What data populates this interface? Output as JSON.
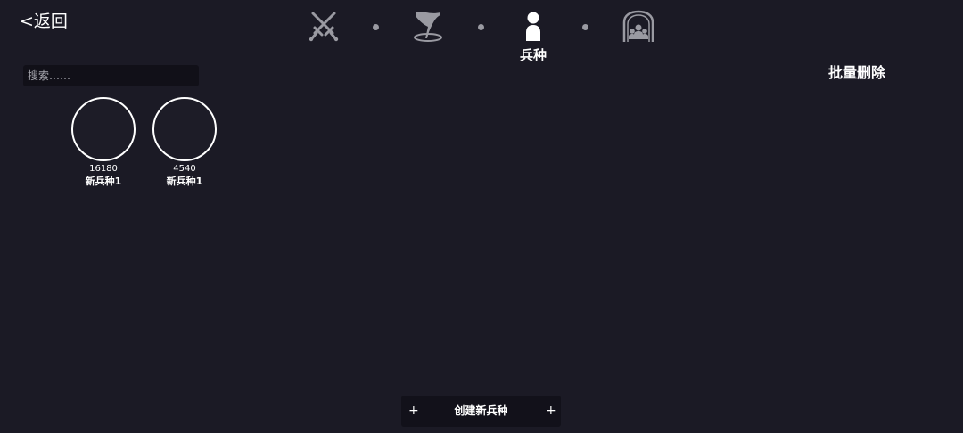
{
  "header": {
    "back_label": "<返回",
    "batch_delete_label": "批量删除"
  },
  "nav": {
    "steps": [
      {
        "icon": "crossed-swords-icon",
        "label": "",
        "active": false
      },
      {
        "icon": "flag-icon",
        "label": "",
        "active": false
      },
      {
        "icon": "soldier-icon",
        "label": "兵种",
        "active": true
      },
      {
        "icon": "army-group-icon",
        "label": "",
        "active": false
      }
    ]
  },
  "search": {
    "placeholder": "搜索……",
    "value": ""
  },
  "units": [
    {
      "count": "16180",
      "name": "新兵种1"
    },
    {
      "count": "4540",
      "name": "新兵种1"
    }
  ],
  "create": {
    "plus_left": "+",
    "label": "创建新兵种",
    "plus_right": "+"
  },
  "colors": {
    "background": "#1b1a25",
    "inactive_icon": "#9a9aa2",
    "active_icon": "#ffffff",
    "panel_dark": "#111018"
  }
}
